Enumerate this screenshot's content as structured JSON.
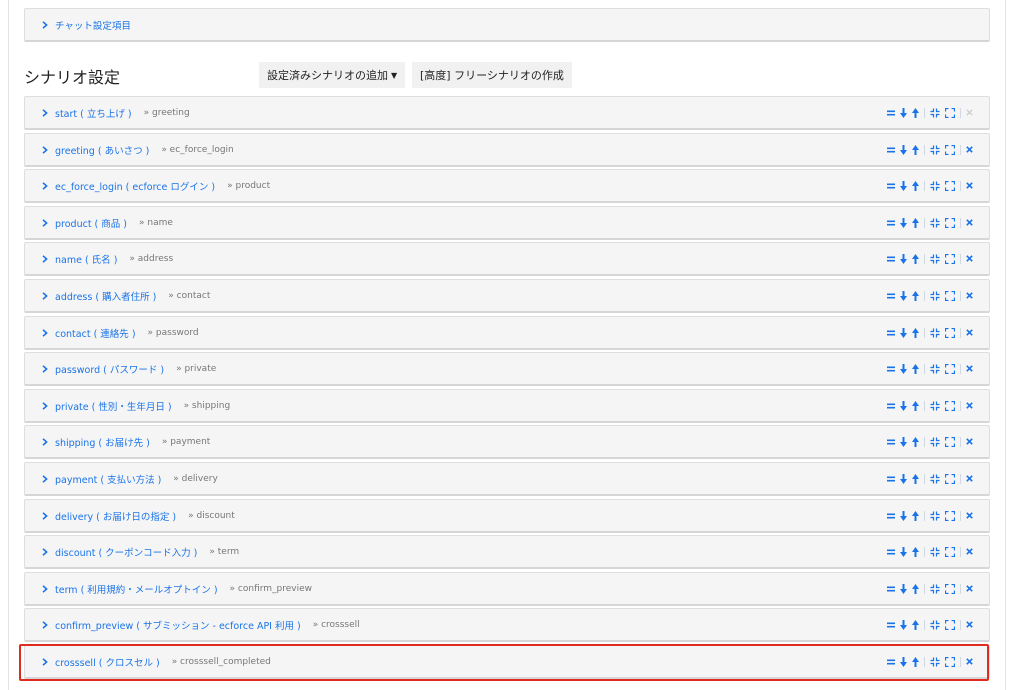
{
  "chat_settings": {
    "label": "チャット設定項目"
  },
  "scenario": {
    "title": "シナリオ設定",
    "add_button": "設定済みシナリオの追加",
    "free_button": "[高度] フリーシナリオの作成"
  },
  "colors": {
    "link": "#1a73e8",
    "highlight": "#e02b20"
  },
  "rows": [
    {
      "label": "start ( 立ち上げ )",
      "next": "» greeting",
      "delete_disabled": true
    },
    {
      "label": "greeting ( あいさつ )",
      "next": "» ec_force_login"
    },
    {
      "label": "ec_force_login ( ecforce ログイン )",
      "next": "» product"
    },
    {
      "label": "product ( 商品 )",
      "next": "» name"
    },
    {
      "label": "name ( 氏名 )",
      "next": "» address"
    },
    {
      "label": "address ( 購入者住所 )",
      "next": "» contact"
    },
    {
      "label": "contact ( 連絡先 )",
      "next": "» password"
    },
    {
      "label": "password ( パスワード )",
      "next": "» private"
    },
    {
      "label": "private ( 性別・生年月日 )",
      "next": "» shipping"
    },
    {
      "label": "shipping ( お届け先 )",
      "next": "» payment"
    },
    {
      "label": "payment ( 支払い方法 )",
      "next": "» delivery"
    },
    {
      "label": "delivery ( お届け日の指定 )",
      "next": "» discount"
    },
    {
      "label": "discount ( クーポンコード入力 )",
      "next": "» term"
    },
    {
      "label": "term ( 利用規約・メールオプトイン )",
      "next": "» confirm_preview"
    },
    {
      "label": "confirm_preview ( サブミッション - ecforce API 利用 )",
      "next": "» crosssell"
    },
    {
      "label": "crosssell ( クロスセル )",
      "next": "» crosssell_completed",
      "highlighted": true
    }
  ]
}
